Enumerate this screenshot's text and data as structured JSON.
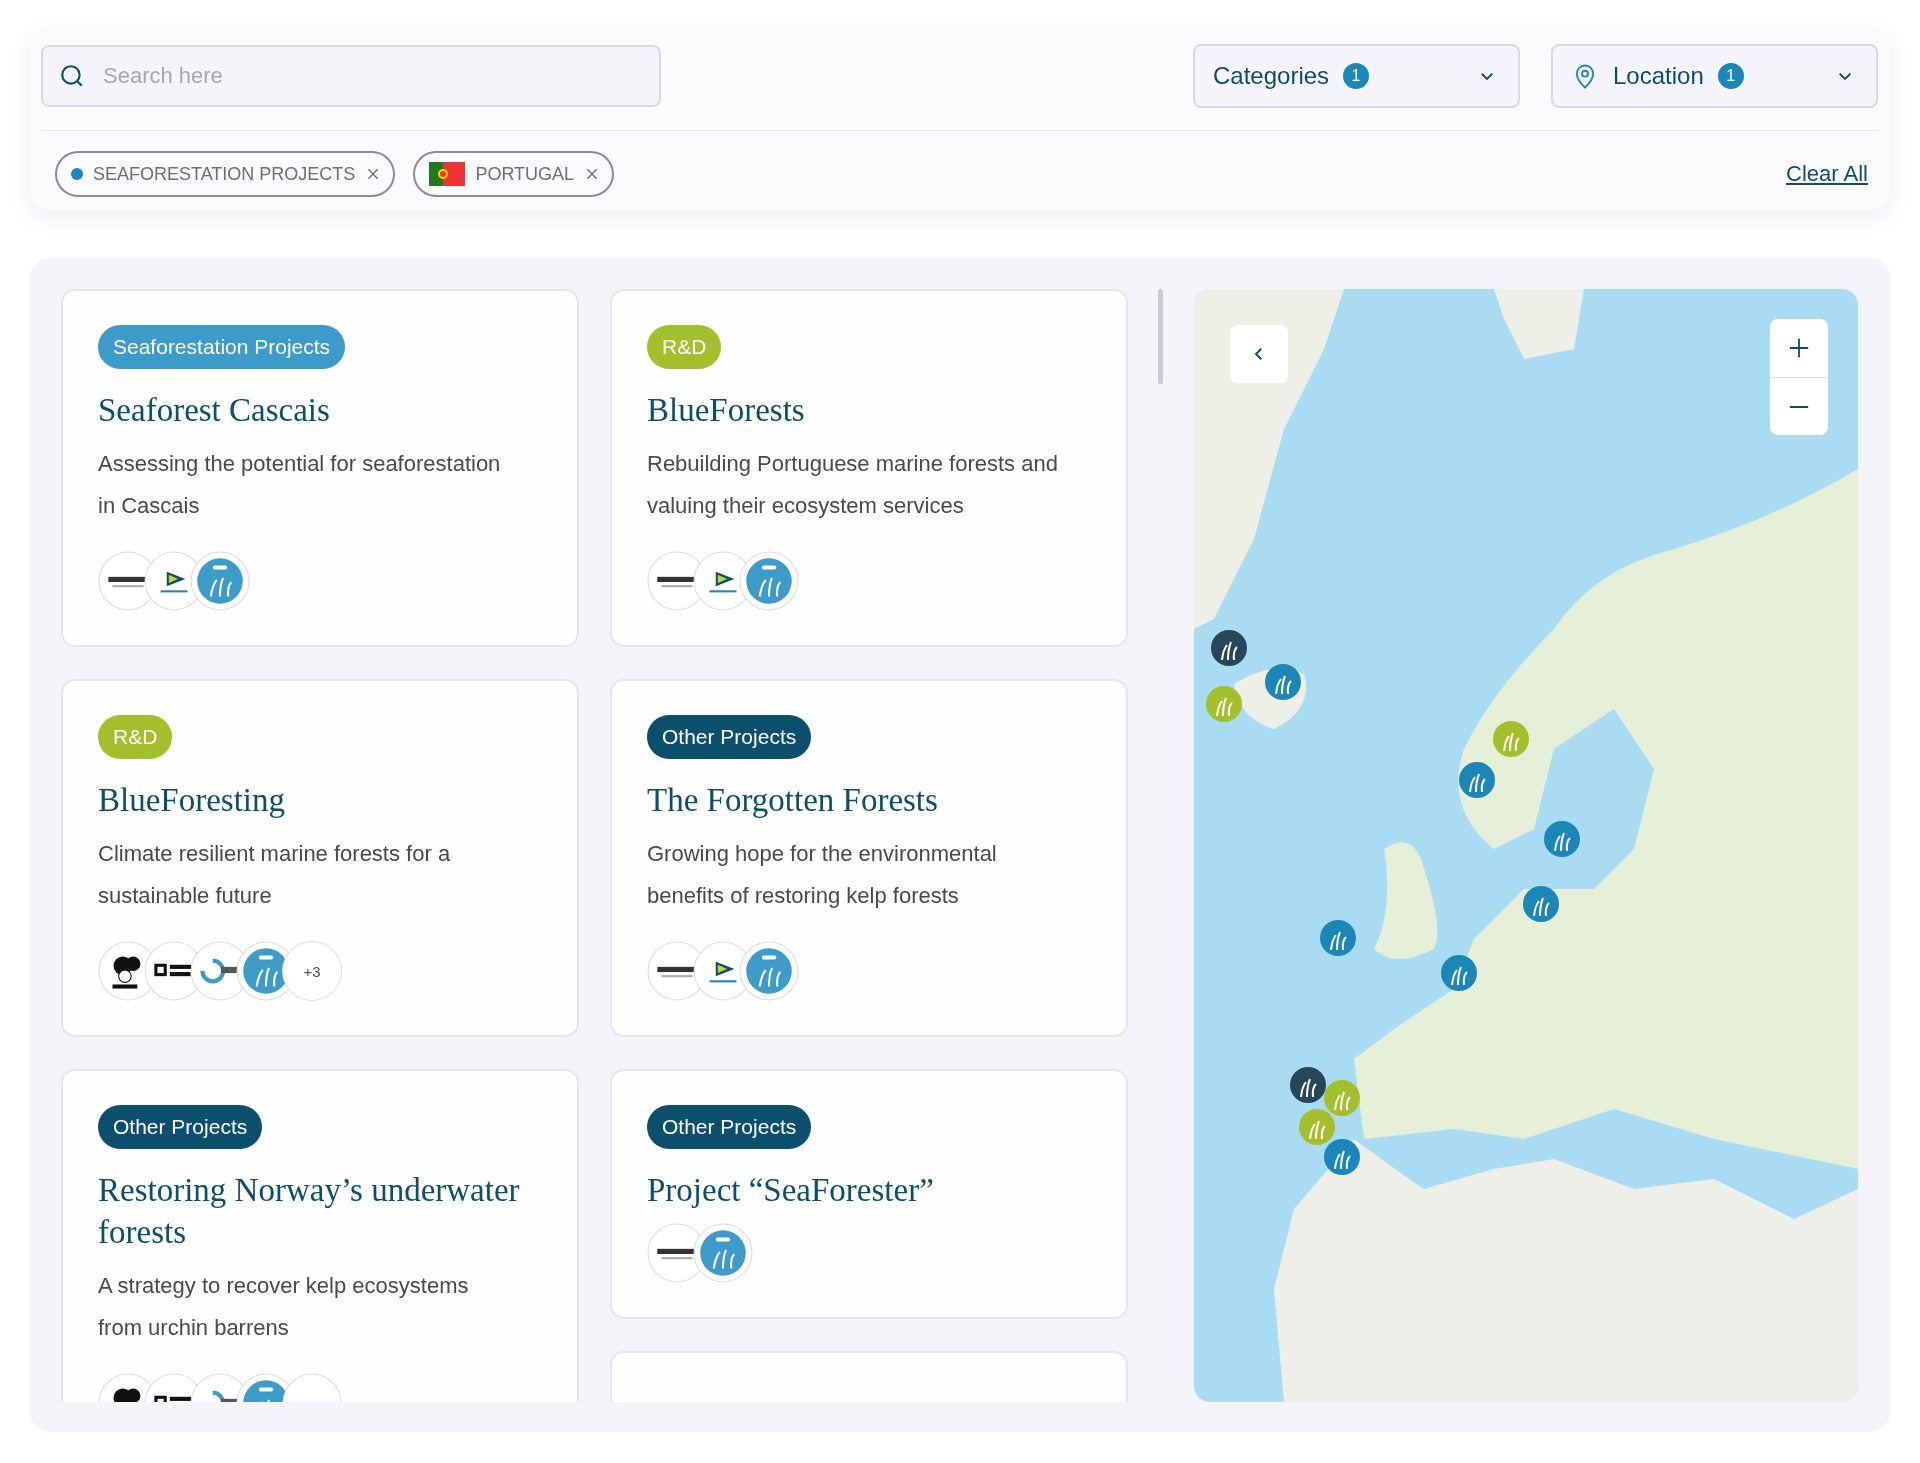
{
  "search": {
    "placeholder": "Search here"
  },
  "dropdowns": [
    {
      "kind": "categories",
      "label": "Categories",
      "count": "1"
    },
    {
      "kind": "location",
      "label": "Location",
      "count": "1"
    }
  ],
  "chips": [
    {
      "kind": "dot",
      "label": "SEAFORESTATION PROJECTS",
      "color": "#1a87b8"
    },
    {
      "kind": "flag",
      "label": "PORTUGAL"
    }
  ],
  "clear_all": "Clear All",
  "cards": [
    {
      "kind": "project",
      "tag": "Seaforestation Projects",
      "color": "#3d9bc9",
      "title": "Seaforest Cascais",
      "description": "Assessing the potential for seaforestation in Cascais",
      "logos": [
        {
          "kind": "cascais"
        },
        {
          "kind": "naval"
        },
        {
          "kind": "seaforester"
        }
      ]
    },
    {
      "kind": "project",
      "tag": "R&D",
      "color": "#a5be2b",
      "title": "BlueForests",
      "description": "Rebuilding Portuguese marine forests and valuing their ecosystem services",
      "logos": [
        {
          "kind": "cascais"
        },
        {
          "kind": "naval"
        },
        {
          "kind": "seaforester"
        }
      ]
    },
    {
      "kind": "project",
      "tag": "R&D",
      "color": "#a5be2b",
      "title": "BlueForesting",
      "description": "Climate resilient marine forests for a sustainable future",
      "logos": [
        {
          "kind": "wwf"
        },
        {
          "kind": "politecnico"
        },
        {
          "kind": "mare"
        },
        {
          "kind": "seaforester"
        }
      ],
      "more": "+3"
    },
    {
      "kind": "project",
      "tag": "Other Projects",
      "color": "#0c4f6c",
      "title": "The Forgotten Forests",
      "description": "Growing hope for the environmental benefits of restoring kelp forests",
      "logos": [
        {
          "kind": "cascais"
        },
        {
          "kind": "naval"
        },
        {
          "kind": "seaforester"
        }
      ]
    },
    {
      "kind": "project",
      "tag": "Other Projects",
      "color": "#0c4f6c",
      "title": "Restoring Norway’s underwater forests",
      "description": "A strategy to recover kelp ecosystems from urchin barrens",
      "logos": [
        {
          "kind": "wwf"
        },
        {
          "kind": "politecnico"
        },
        {
          "kind": "mare"
        },
        {
          "kind": "seaforester"
        },
        {
          "kind": "blank"
        }
      ]
    },
    {
      "kind": "project",
      "tag": "Other Projects",
      "color": "#0c4f6c",
      "title": "Project “SeaForester”",
      "logos": [
        {
          "kind": "cascais"
        },
        {
          "kind": "seaforester"
        }
      ]
    },
    {
      "kind": "partial"
    }
  ],
  "map": {
    "markers": [
      {
        "color": "#274659"
      },
      {
        "color": "#1a87b8"
      },
      {
        "color": "#a5be2b"
      },
      {
        "color": "#a5be2b"
      },
      {
        "color": "#1a87b8"
      },
      {
        "color": "#1a87b8"
      },
      {
        "color": "#1a87b8"
      },
      {
        "color": "#1a87b8"
      },
      {
        "color": "#1a87b8"
      },
      {
        "color": "#274659"
      },
      {
        "color": "#a5be2b"
      },
      {
        "color": "#a5be2b"
      },
      {
        "color": "#1a87b8"
      }
    ]
  }
}
